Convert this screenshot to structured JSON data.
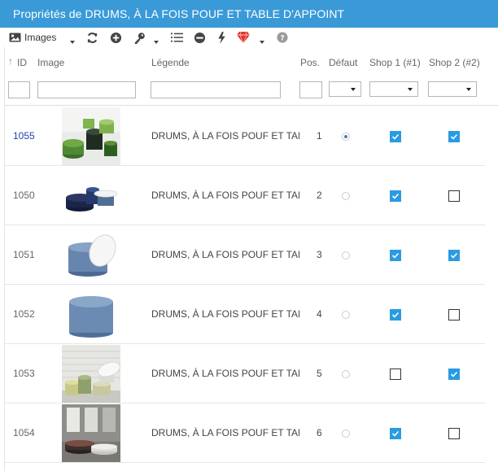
{
  "window": {
    "title": "Propriétés de DRUMS, À LA FOIS POUF ET TABLE D'APPOINT"
  },
  "toolbar": {
    "images_label": "Images",
    "icons": [
      "image-icon",
      "refresh-icon",
      "add-icon",
      "key-icon",
      "list-icon",
      "remove-icon",
      "lightning-icon",
      "gem-icon",
      "help-icon"
    ]
  },
  "columns": {
    "id": "ID",
    "image": "Image",
    "legend": "Légende",
    "pos": "Pos.",
    "default": "Défaut",
    "shop1": "Shop 1 (#1)",
    "shop2": "Shop 2 (#2)"
  },
  "rows": [
    {
      "id": "1055",
      "legend": "DRUMS, À LA FOIS POUF ET TABLE D'APPOINT",
      "pos": "1",
      "default": true,
      "shop1": true,
      "shop2": true,
      "active": true
    },
    {
      "id": "1050",
      "legend": "DRUMS, À LA FOIS POUF ET TABLE D'APPOINT",
      "pos": "2",
      "default": false,
      "shop1": true,
      "shop2": false,
      "active": false
    },
    {
      "id": "1051",
      "legend": "DRUMS, À LA FOIS POUF ET TABLE D'APPOINT",
      "pos": "3",
      "default": false,
      "shop1": true,
      "shop2": true,
      "active": false
    },
    {
      "id": "1052",
      "legend": "DRUMS, À LA FOIS POUF ET TABLE D'APPOINT",
      "pos": "4",
      "default": false,
      "shop1": true,
      "shop2": false,
      "active": false
    },
    {
      "id": "1053",
      "legend": "DRUMS, À LA FOIS POUF ET TABLE D'APPOINT",
      "pos": "5",
      "default": false,
      "shop1": false,
      "shop2": true,
      "active": false
    },
    {
      "id": "1054",
      "legend": "DRUMS, À LA FOIS POUF ET TABLE D'APPOINT",
      "pos": "6",
      "default": false,
      "shop1": true,
      "shop2": false,
      "active": false
    }
  ],
  "colors": {
    "header": "#3a9ad8",
    "checkbox": "#2a9be2",
    "active_id": "#1d3fae"
  }
}
